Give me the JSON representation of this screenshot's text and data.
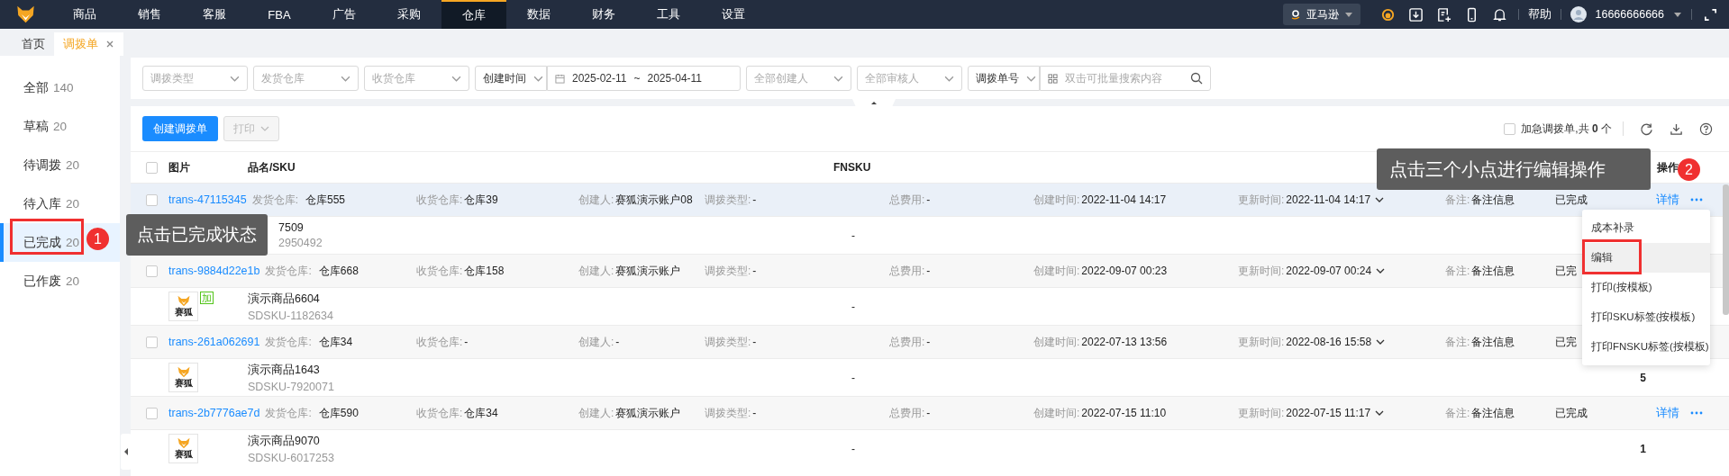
{
  "nav": {
    "items": [
      {
        "label": "商品",
        "selected": false
      },
      {
        "label": "销售",
        "selected": false
      },
      {
        "label": "客服",
        "selected": false
      },
      {
        "label": "FBA",
        "selected": false
      },
      {
        "label": "广告",
        "selected": false
      },
      {
        "label": "采购",
        "selected": false
      },
      {
        "label": "仓库",
        "selected": true
      },
      {
        "label": "数据",
        "selected": false
      },
      {
        "label": "财务",
        "selected": false
      },
      {
        "label": "工具",
        "selected": false
      },
      {
        "label": "设置",
        "selected": false
      }
    ],
    "marketplace": "亚马逊",
    "help": "帮助",
    "user": "16666666666"
  },
  "tabs": [
    {
      "label": "首页",
      "selected": false,
      "closable": false
    },
    {
      "label": "调拨单",
      "selected": true,
      "closable": true
    }
  ],
  "sidebar": {
    "items": [
      {
        "label": "全部",
        "count": "140",
        "selected": false
      },
      {
        "label": "草稿",
        "count": "20",
        "selected": false
      },
      {
        "label": "待调拨",
        "count": "20",
        "selected": false
      },
      {
        "label": "待入库",
        "count": "20",
        "selected": false
      },
      {
        "label": "已完成",
        "count": "20",
        "selected": true
      },
      {
        "label": "已作废",
        "count": "20",
        "selected": false
      }
    ]
  },
  "filters": [
    {
      "kind": "select",
      "placeholder": "调拨类型"
    },
    {
      "kind": "select",
      "placeholder": "发货仓库"
    },
    {
      "kind": "select",
      "placeholder": "收货仓库"
    },
    {
      "kind": "value-select",
      "value": "创建时间"
    },
    {
      "kind": "daterange",
      "start": "2025-02-11",
      "separator": "~",
      "end": "2025-04-11"
    },
    {
      "kind": "select",
      "placeholder": "全部创建人"
    },
    {
      "kind": "select",
      "placeholder": "全部审核人"
    },
    {
      "kind": "value-select",
      "value": "调拨单号"
    },
    {
      "kind": "search",
      "placeholder": "双击可批量搜索内容"
    }
  ],
  "toolbar": {
    "create": "创建调拨单",
    "print": "打印",
    "print_disabled": true,
    "urgent_checked": false,
    "urgent_label": "加急调拨单,共 **0** 个"
  },
  "table": {
    "select_all_checked": false,
    "columns": [
      {
        "label": "图片"
      },
      {
        "label": "品名/SKU"
      },
      {
        "label": "FNSKU"
      },
      {
        "label": "操作"
      }
    ],
    "rows": [
      {
        "id": "trans-47115345",
        "checked": false,
        "highlighted": true,
        "fields": [
          {
            "kind": "text",
            "label": "发货仓库:",
            "value": "仓库555"
          },
          {
            "kind": "text",
            "label": "收货仓库:",
            "value": "仓库39"
          },
          {
            "kind": "text",
            "label": "创建人:",
            "value": "赛狐演示账户08"
          },
          {
            "kind": "text",
            "label": "调拨类型:",
            "value": "-"
          },
          {
            "kind": "text",
            "label": "总费用:",
            "value": "-"
          },
          {
            "kind": "text",
            "label": "创建时间:",
            "value": "2022-11-04 14:17"
          },
          {
            "kind": "dropdown",
            "label": "更新时间:",
            "value": "2022-11-04 14:17"
          },
          {
            "kind": "text",
            "label": "备注:",
            "value": "备注信息"
          }
        ],
        "status": "已完成",
        "detail_link": "详情",
        "more": true,
        "product": {
          "image": false,
          "cut_off": true,
          "name": "7509",
          "sku": "2950492",
          "fnsku": "-"
        }
      },
      {
        "id": "trans-9884d22e1b",
        "checked": false,
        "highlighted": false,
        "fields": [
          {
            "kind": "text",
            "label": "发货仓库:",
            "value": "仓库668"
          },
          {
            "kind": "text",
            "label": "收货仓库:",
            "value": "仓库158"
          },
          {
            "kind": "text",
            "label": "创建人:",
            "value": "赛狐演示账户"
          },
          {
            "kind": "text",
            "label": "调拨类型:",
            "value": "-"
          },
          {
            "kind": "text",
            "label": "总费用:",
            "value": "-"
          },
          {
            "kind": "text",
            "label": "创建时间:",
            "value": "2022-09-07 00:23"
          },
          {
            "kind": "dropdown",
            "label": "更新时间:",
            "value": "2022-09-07 00:24"
          },
          {
            "kind": "text",
            "label": "备注:",
            "value": "备注信息"
          }
        ],
        "status": "已完",
        "more": false,
        "product": {
          "image": true,
          "caption": "赛狐",
          "tag": "加",
          "cut_off": false,
          "name": "演示商品6604",
          "sku": "SDSKU-1182634",
          "fnsku": "-"
        }
      },
      {
        "id": "trans-261a062691",
        "checked": false,
        "highlighted": false,
        "fields": [
          {
            "kind": "text",
            "label": "发货仓库:",
            "value": "仓库34"
          },
          {
            "kind": "text",
            "label": "收货仓库:",
            "value": "-"
          },
          {
            "kind": "text",
            "label": "创建人:",
            "value": "-"
          },
          {
            "kind": "text",
            "label": "调拨类型:",
            "value": "-"
          },
          {
            "kind": "text",
            "label": "总费用:",
            "value": "-"
          },
          {
            "kind": "text",
            "label": "创建时间:",
            "value": "2022-07-13 13:56"
          },
          {
            "kind": "dropdown",
            "label": "更新时间:",
            "value": "2022-08-16 15:58"
          },
          {
            "kind": "text",
            "label": "备注:",
            "value": "备注信息"
          }
        ],
        "status": "已完",
        "more": false,
        "product": {
          "image": true,
          "caption": "赛狐",
          "cut_off": false,
          "name": "演示商品1643",
          "sku": "SDSKU-7920071",
          "fnsku": "-",
          "quantity": "5"
        }
      },
      {
        "id": "trans-2b7776ae7d",
        "checked": false,
        "highlighted": false,
        "fields": [
          {
            "kind": "text",
            "label": "发货仓库:",
            "value": "仓库590"
          },
          {
            "kind": "text",
            "label": "收货仓库:",
            "value": "仓库34"
          },
          {
            "kind": "text",
            "label": "创建人:",
            "value": "赛狐演示账户"
          },
          {
            "kind": "text",
            "label": "调拨类型:",
            "value": "-"
          },
          {
            "kind": "text",
            "label": "总费用:",
            "value": "-"
          },
          {
            "kind": "text",
            "label": "创建时间:",
            "value": "2022-07-15 11:10"
          },
          {
            "kind": "dropdown",
            "label": "更新时间:",
            "value": "2022-07-15 11:17"
          },
          {
            "kind": "text",
            "label": "备注:",
            "value": "备注信息"
          }
        ],
        "status": "已完成",
        "detail_link": "详情",
        "more": true,
        "product": {
          "image": true,
          "caption": "赛狐",
          "cut_off": false,
          "name": "演示商品9070",
          "sku": "SDSKU-6017253",
          "fnsku": "-",
          "quantity": "1"
        }
      }
    ]
  },
  "menu": {
    "items": [
      {
        "label": "成本补录",
        "selected": false
      },
      {
        "label": "编辑",
        "selected": true
      },
      {
        "label": "打印(按模板)",
        "selected": false
      },
      {
        "label": "打印SKU标签(按模板)",
        "selected": false
      },
      {
        "label": "打印FNSKU标签(按模板)",
        "selected": false
      }
    ]
  },
  "callouts": [
    {
      "number": "1",
      "text": "点击已完成状态"
    },
    {
      "number": "2",
      "text": "点击三个小点进行编辑操作"
    }
  ]
}
